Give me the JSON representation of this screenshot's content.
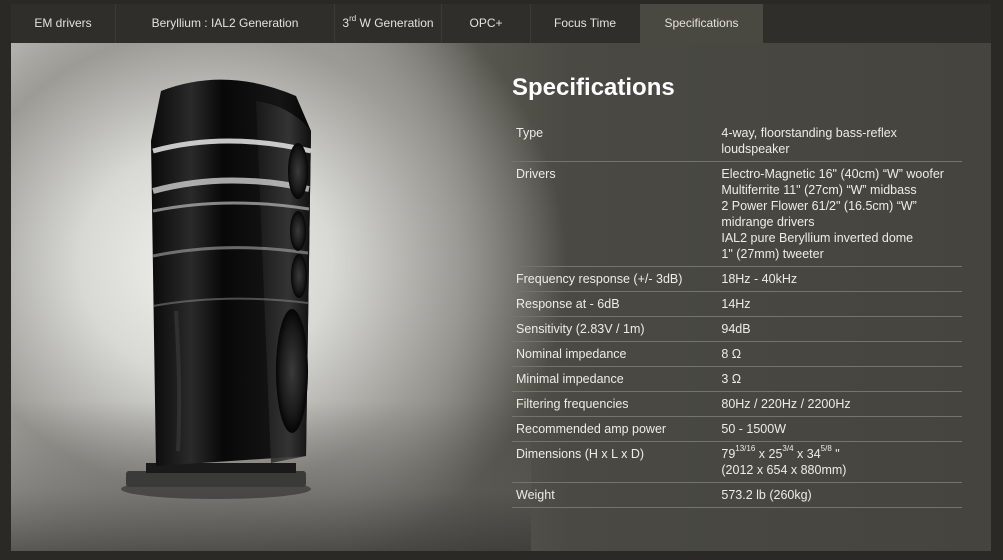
{
  "tabs": [
    {
      "label": "EM drivers",
      "active": false
    },
    {
      "label": "Beryllium : IAL2 Generation",
      "active": false
    },
    {
      "label_main": "3",
      "label_sup": "rd",
      "label_rest": " W Generation",
      "active": false
    },
    {
      "label": "OPC+",
      "active": false
    },
    {
      "label": "Focus Time",
      "active": false
    },
    {
      "label": "Specifications",
      "active": true
    }
  ],
  "specs": {
    "title": "Specifications",
    "rows": [
      {
        "key": "Type",
        "lines": [
          "4-way, floorstanding bass-reflex",
          "loudspeaker"
        ]
      },
      {
        "key": "Drivers",
        "lines": [
          "Electro-Magnetic 16\" (40cm) “W” woofer",
          "Multiferrite 11\" (27cm) “W” midbass",
          "2 Power Flower 61/2\" (16.5cm) “W”",
          "midrange drivers",
          "IAL2 pure Beryllium inverted dome",
          "1\" (27mm) tweeter"
        ]
      },
      {
        "key": "Frequency response (+/- 3dB)",
        "lines": [
          "18Hz - 40kHz"
        ]
      },
      {
        "key": "Response at - 6dB",
        "lines": [
          "14Hz"
        ]
      },
      {
        "key": "Sensitivity (2.83V / 1m)",
        "lines": [
          "94dB"
        ]
      },
      {
        "key": "Nominal impedance",
        "lines": [
          "8 Ω"
        ]
      },
      {
        "key": "Minimal impedance",
        "lines": [
          "3 Ω"
        ]
      },
      {
        "key": "Filtering frequencies",
        "lines": [
          "80Hz / 220Hz / 2200Hz"
        ]
      },
      {
        "key": "Recommended amp power",
        "lines": [
          "50 - 1500W"
        ]
      }
    ],
    "dimensions": {
      "key": "Dimensions (H x L x D)",
      "h_main": "79",
      "h_frac": "13/16",
      "x1": " x ",
      "l_main": "25",
      "l_frac": "3/4",
      "x2": " x ",
      "d_main": "34",
      "d_frac": "5/8",
      "unit": " \"",
      "metric": "(2012 x 654 x 880mm)"
    },
    "weight": {
      "key": "Weight",
      "value": "573.2 lb (260kg)"
    }
  },
  "colors": {
    "background": "#2a2925",
    "tab_active": "#4a4941",
    "text": "#eeece6"
  },
  "icons": [
    "speaker-product-image"
  ]
}
